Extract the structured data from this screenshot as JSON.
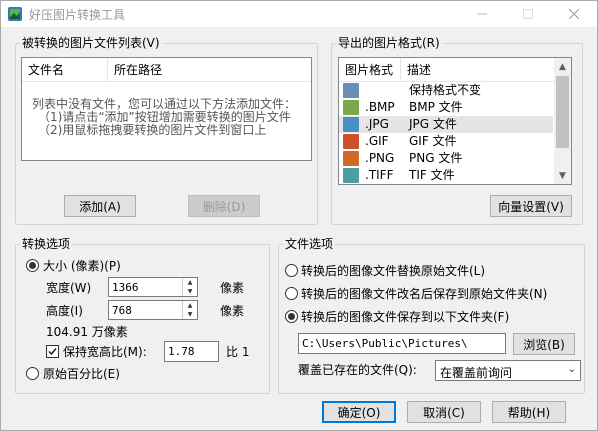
{
  "window": {
    "title": "好压图片转换工具"
  },
  "source_list": {
    "legend": "被转换的图片文件列表(V)",
    "columns": [
      "文件名",
      "所在路径"
    ],
    "empty_line1": "列表中没有文件，您可以通过以下方法添加文件：",
    "empty_line2": "（1)请点击“添加”按钮增加需要转换的图片文件",
    "empty_line3": "（2)用鼠标拖拽要转换的图片文件到窗口上",
    "add_button": "添加(A)",
    "delete_button": "删除(D)"
  },
  "export_format": {
    "legend": "导出的图片格式(R)",
    "columns": [
      "图片格式",
      "描述"
    ],
    "rows": [
      {
        "ext": "",
        "desc": "保持格式不变",
        "icon": "keep-format-icon",
        "color": "#6a8fb5"
      },
      {
        "ext": ".BMP",
        "desc": "BMP 文件",
        "icon": "bmp-file-icon",
        "color": "#7aa84a"
      },
      {
        "ext": ".JPG",
        "desc": "JPG 文件",
        "icon": "jpg-file-icon",
        "color": "#4a90c8"
      },
      {
        "ext": ".GIF",
        "desc": "GIF 文件",
        "icon": "gif-file-icon",
        "color": "#d0502a"
      },
      {
        "ext": ".PNG",
        "desc": "PNG 文件",
        "icon": "png-file-icon",
        "color": "#d06a2a"
      },
      {
        "ext": ".TIFF",
        "desc": "TIF 文件",
        "icon": "tiff-file-icon",
        "color": "#4aa0a0"
      }
    ],
    "selected_index": 2,
    "wizard_button": "向量设置(V)"
  },
  "convert_options": {
    "legend": "转换选项",
    "size_radio": "大小 (像素)(P)",
    "width_label": "宽度(W)",
    "width_value": "1366",
    "width_unit": "像素",
    "height_label": "高度(I)",
    "height_value": "768",
    "height_unit": "像素",
    "pixels_total": "104.91 万像素",
    "keep_ratio_label": "保持宽高比(M):",
    "ratio_value": "1.78",
    "ratio_suffix": "比 1",
    "percent_radio": "原始百分比(E)"
  },
  "file_options": {
    "legend": "文件选项",
    "opt_replace": "转换后的图像文件替换原始文件(L)",
    "opt_rename": "转换后的图像文件改名后保存到原始文件夹(N)",
    "opt_save_to": "转换后的图像文件保存到以下文件夹(F)",
    "folder_path": "C:\\Users\\Public\\Pictures\\",
    "browse_button": "浏览(B)",
    "overwrite_label": "覆盖已存在的文件(Q):",
    "overwrite_value": "在覆盖前询问"
  },
  "footer": {
    "ok": "确定(O)",
    "cancel": "取消(C)",
    "help": "帮助(H)"
  },
  "colors": {
    "accent": "#0078d7",
    "radio_selected": "#333333"
  }
}
